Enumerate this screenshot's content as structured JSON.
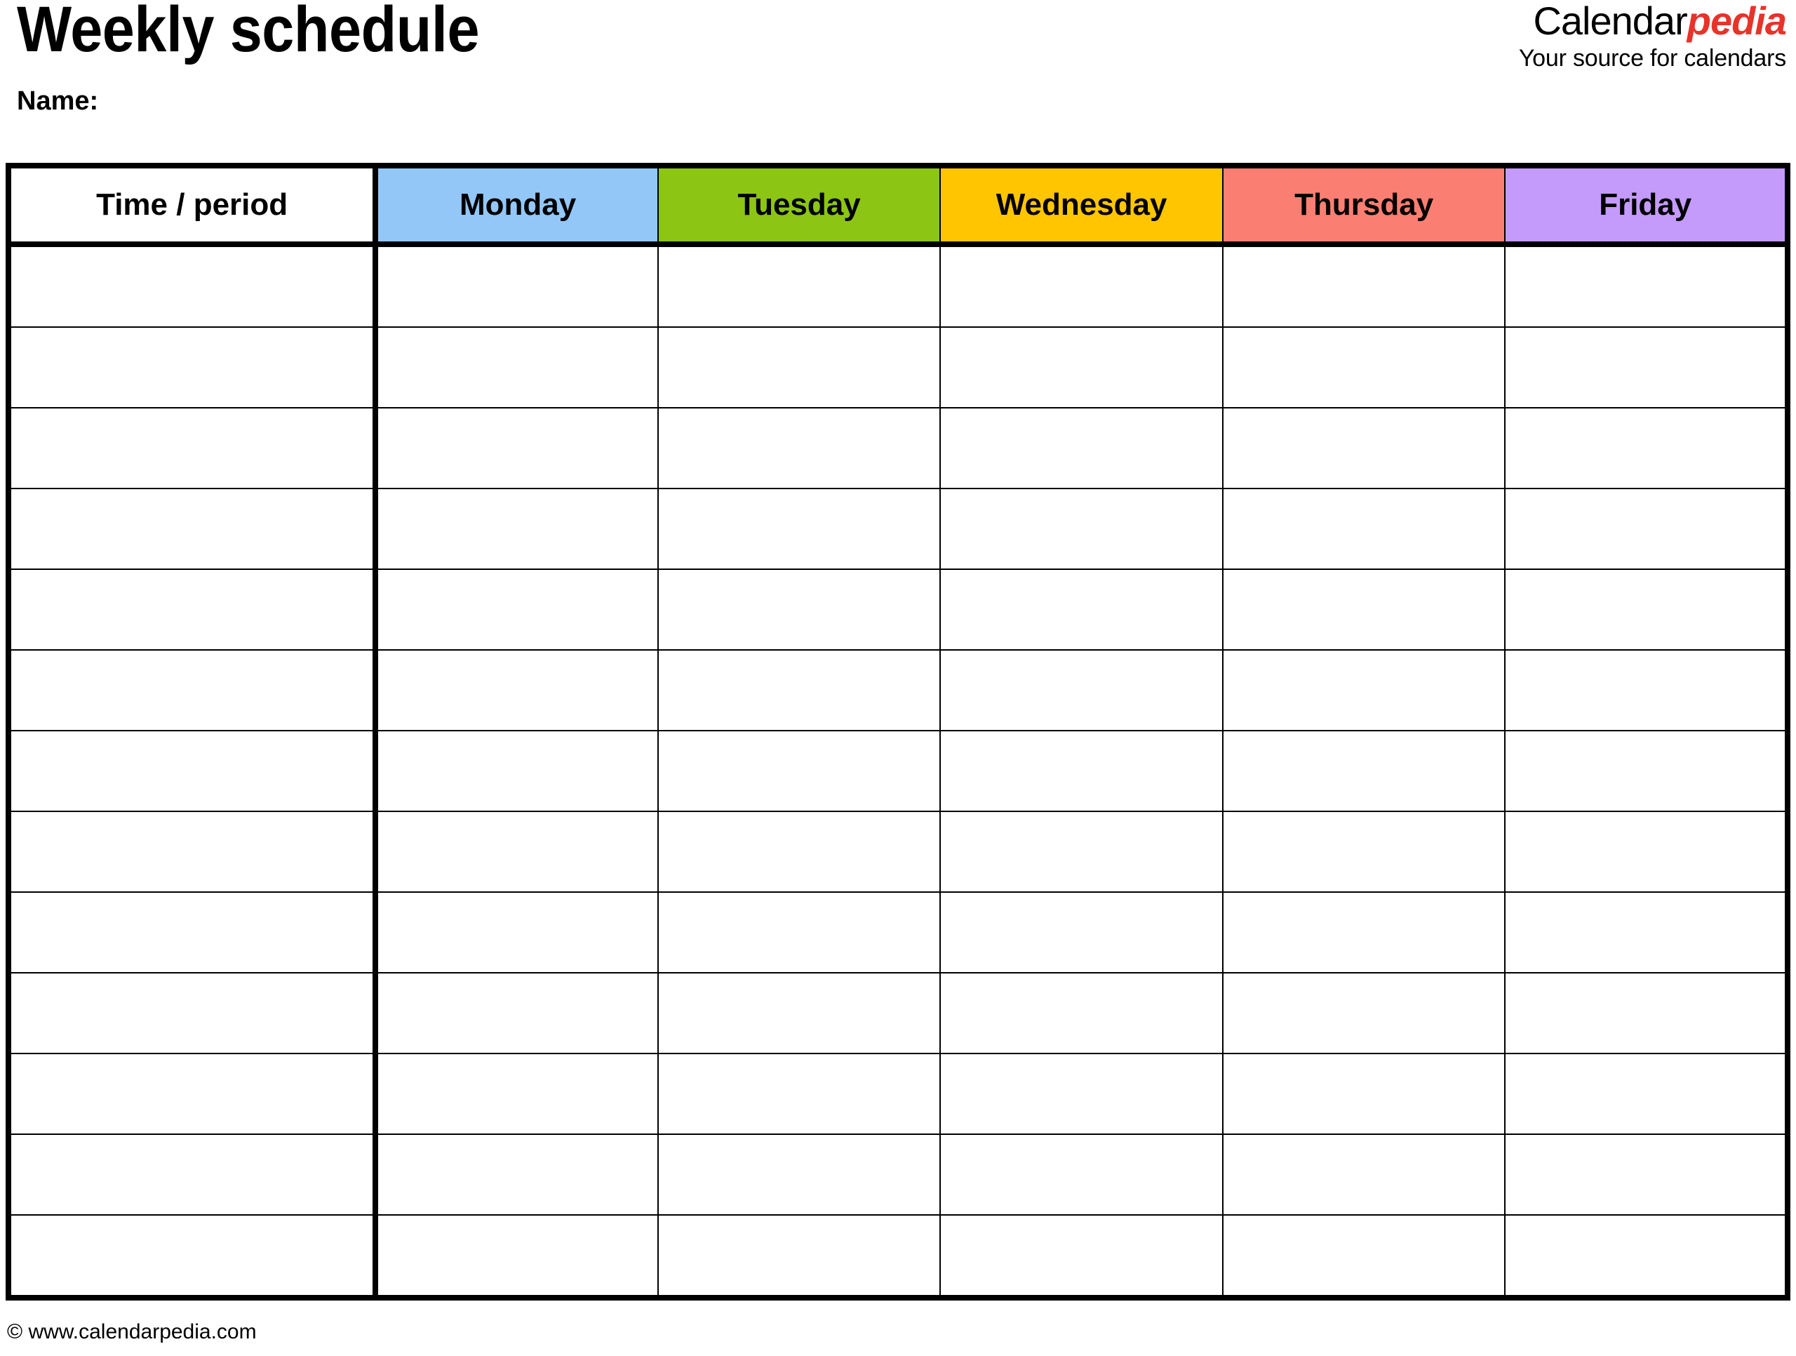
{
  "document": {
    "title": "Weekly schedule",
    "name_label": "Name:"
  },
  "brand": {
    "word_first": "Calendar",
    "word_second": "pedia",
    "tagline": "Your source for calendars",
    "accent_color": "#e8322a"
  },
  "table": {
    "columns": [
      {
        "key": "time",
        "label": "Time / period",
        "header_bg": "#ffffff"
      },
      {
        "key": "monday",
        "label": "Monday",
        "header_bg": "#93c7f8"
      },
      {
        "key": "tuesday",
        "label": "Tuesday",
        "header_bg": "#8cc513"
      },
      {
        "key": "wednesday",
        "label": "Wednesday",
        "header_bg": "#ffc600"
      },
      {
        "key": "thursday",
        "label": "Thursday",
        "header_bg": "#fa7f72"
      },
      {
        "key": "friday",
        "label": "Friday",
        "header_bg": "#c49bfb"
      }
    ],
    "row_count": 13,
    "rows": [
      {
        "time": "",
        "monday": "",
        "tuesday": "",
        "wednesday": "",
        "thursday": "",
        "friday": ""
      },
      {
        "time": "",
        "monday": "",
        "tuesday": "",
        "wednesday": "",
        "thursday": "",
        "friday": ""
      },
      {
        "time": "",
        "monday": "",
        "tuesday": "",
        "wednesday": "",
        "thursday": "",
        "friday": ""
      },
      {
        "time": "",
        "monday": "",
        "tuesday": "",
        "wednesday": "",
        "thursday": "",
        "friday": ""
      },
      {
        "time": "",
        "monday": "",
        "tuesday": "",
        "wednesday": "",
        "thursday": "",
        "friday": ""
      },
      {
        "time": "",
        "monday": "",
        "tuesday": "",
        "wednesday": "",
        "thursday": "",
        "friday": ""
      },
      {
        "time": "",
        "monday": "",
        "tuesday": "",
        "wednesday": "",
        "thursday": "",
        "friday": ""
      },
      {
        "time": "",
        "monday": "",
        "tuesday": "",
        "wednesday": "",
        "thursday": "",
        "friday": ""
      },
      {
        "time": "",
        "monday": "",
        "tuesday": "",
        "wednesday": "",
        "thursday": "",
        "friday": ""
      },
      {
        "time": "",
        "monday": "",
        "tuesday": "",
        "wednesday": "",
        "thursday": "",
        "friday": ""
      },
      {
        "time": "",
        "monday": "",
        "tuesday": "",
        "wednesday": "",
        "thursday": "",
        "friday": ""
      },
      {
        "time": "",
        "monday": "",
        "tuesday": "",
        "wednesday": "",
        "thursday": "",
        "friday": ""
      },
      {
        "time": "",
        "monday": "",
        "tuesday": "",
        "wednesday": "",
        "thursday": "",
        "friday": ""
      }
    ]
  },
  "footer": {
    "copyright": "© www.calendarpedia.com"
  }
}
